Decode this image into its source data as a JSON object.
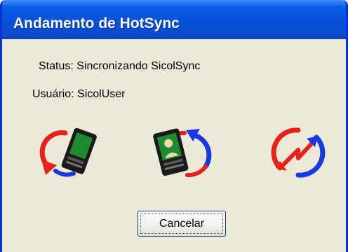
{
  "window": {
    "title": "Andamento de HotSync"
  },
  "status": {
    "label": "Status:",
    "value": "Sincronizando SicolSync"
  },
  "user": {
    "label": "Usuário:",
    "value": "SicolUser"
  },
  "icons": [
    {
      "name": "handheld-sync-arrow-icon"
    },
    {
      "name": "handheld-contact-sync-icon"
    },
    {
      "name": "sync-arrows-icon"
    }
  ],
  "actions": {
    "cancel_label": "Cancelar"
  },
  "colors": {
    "titlebar": "#0751d8",
    "dialog_bg": "#ece9d8",
    "arrow_red": "#e8201a",
    "arrow_blue": "#1838e0",
    "device_green": "#1f8a2e"
  }
}
